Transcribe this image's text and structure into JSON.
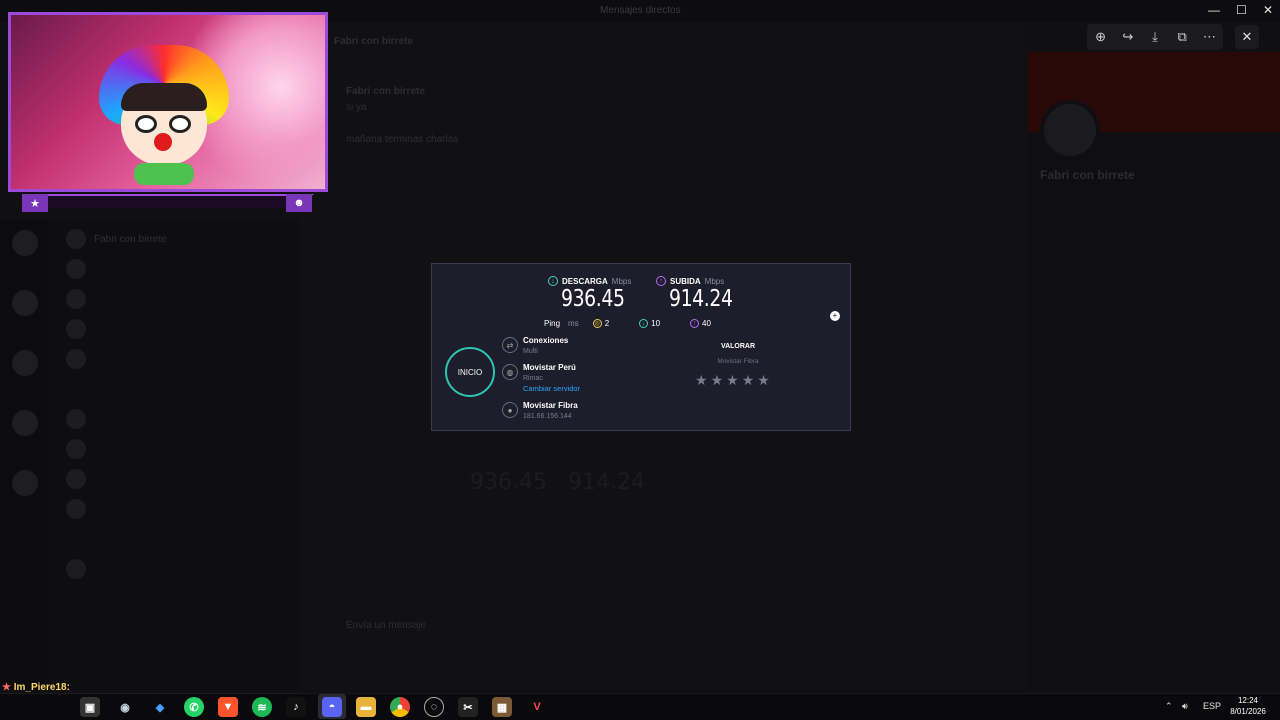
{
  "window": {
    "title": "Mensajes directos",
    "minimize": "—",
    "maximize": "☐",
    "close": "✕"
  },
  "viewer": {
    "tools": [
      "zoom-in",
      "share",
      "download",
      "open-external",
      "more"
    ],
    "close": "✕"
  },
  "chat_bg": {
    "channel_name": "Fabri con birrete",
    "messages": [
      "Fabri con birrete",
      "si ya",
      "mañana terminas charlas"
    ],
    "profile_name": "Fabri con birrete",
    "input_placeholder": "Envía un mensaje"
  },
  "speedtest": {
    "download_label": "DESCARGA",
    "upload_label": "SUBIDA",
    "unit": "Mbps",
    "download_value": "936.45",
    "upload_value": "914.24",
    "ping_label": "Ping",
    "ping_unit": "ms",
    "ping_idle": "2",
    "ping_down": "10",
    "ping_up": "40",
    "start_button": "INICIO",
    "connections_title": "Conexiones",
    "connections_value": "Multi",
    "server_title": "Movistar Perú",
    "server_location": "Rimac",
    "change_server": "Cambiar servidor",
    "provider_title": "Movistar Fibra",
    "provider_ip": "181.66.156.144",
    "rate_title": "VALORAR",
    "rate_provider": "Movistar Fibra",
    "stars": "★"
  },
  "stream_chat": {
    "user": "Im_Piere18:",
    "prefix": "★"
  },
  "taskbar": {
    "tray_lang": "ESP",
    "time": "12:24",
    "date": "8/01/2026",
    "apps": [
      "discord"
    ]
  }
}
